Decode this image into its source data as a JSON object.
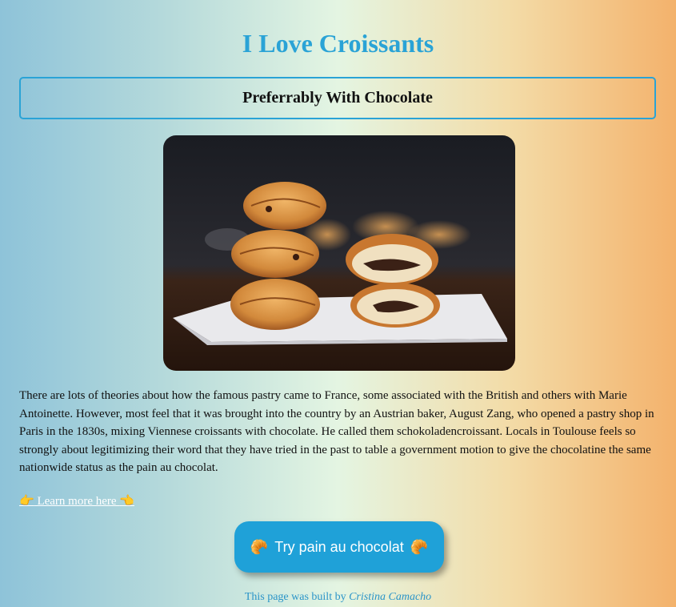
{
  "page": {
    "title": "I Love Croissants",
    "subtitle": "Preferrably With Chocolate",
    "paragraph": "There are lots of theories about how the famous pastry came to France, some associated with the British and others with Marie Antoinette. However, most feel that it was brought into the country by an Austrian baker, August Zang, who opened a pastry shop in Paris in the 1830s, mixing Viennese croissants with chocolate. He called them schokoladencroissant. Locals in Toulouse feels so strongly about legitimizing their word that they have tried in the past to table a government motion to give the chocolatine the same nationwide status as the pain au chocolat.",
    "link": {
      "emoji": "👉",
      "label": " Learn more here ",
      "emoji_end": "👈"
    },
    "button": {
      "icon": "🥐",
      "label": "Try pain au chocolat"
    },
    "footer": {
      "prefix": "This page was built by ",
      "author": "Cristina Camacho"
    }
  },
  "colors": {
    "accent": "#2aa3d6",
    "button_bg": "#1fa1d8",
    "gradient": [
      "#8ec3d9",
      "#e4f5e2",
      "#f3b26c"
    ]
  },
  "icons": {
    "photo": "croissant-photo",
    "pointer_right": "pointing-hand-icon",
    "pointer_left": "pointing-hand-icon",
    "croissant": "croissant-icon"
  }
}
